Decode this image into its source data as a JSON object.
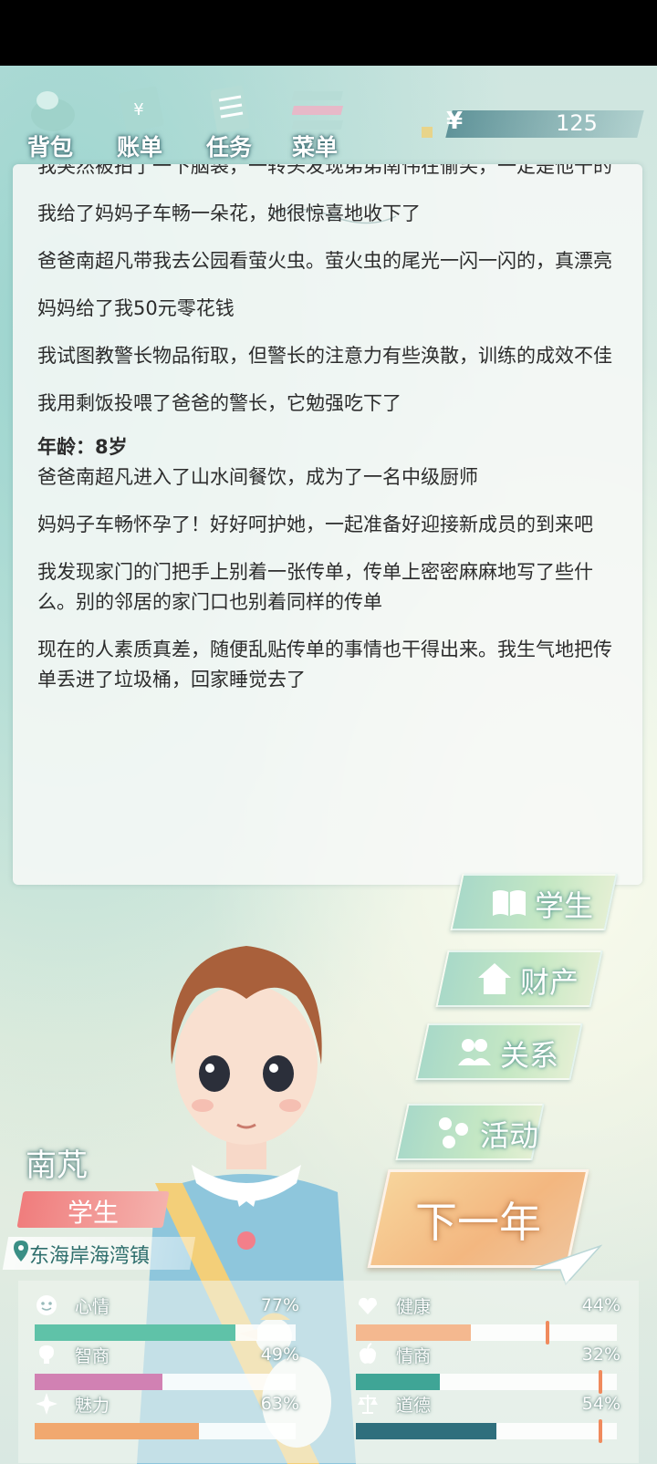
{
  "topbar": {
    "buttons": [
      {
        "label": "背包",
        "icon": "backpack-icon"
      },
      {
        "label": "账单",
        "icon": "bill-icon"
      },
      {
        "label": "任务",
        "icon": "task-icon"
      },
      {
        "label": "菜单",
        "icon": "menu-icon"
      }
    ],
    "money": {
      "symbol": "¥",
      "value": "125"
    }
  },
  "log": {
    "entries": [
      {
        "text": "我突然被拍了一下脑袋，一转头发现弟弟南伟在偷笑，一定是他干的"
      },
      {
        "text": "我给了妈妈子车畅一朵花，她很惊喜地收下了"
      },
      {
        "text": "爸爸南超凡带我去公园看萤火虫。萤火虫的尾光一闪一闪的，真漂亮"
      },
      {
        "text": "妈妈给了我50元零花钱"
      },
      {
        "text": "我试图教警长物品衔取，但警长的注意力有些涣散，训练的成效不佳"
      },
      {
        "text": "我用剩饭投喂了爸爸的警长，它勉强吃下了"
      }
    ],
    "age_heading": "年龄：8岁",
    "entries2": [
      {
        "text": "爸爸南超凡进入了山水间餐饮，成为了一名中级厨师"
      },
      {
        "text": "妈妈子车畅怀孕了！好好呵护她，一起准备好迎接新成员的到来吧"
      },
      {
        "text": "我发现家门的门把手上别着一张传单，传单上密密麻麻地写了些什么。别的邻居的家门口也别着同样的传单"
      },
      {
        "text": "现在的人素质真差，随便乱贴传单的事情也干得出来。我生气地把传单丢进了垃圾桶，回家睡觉去了"
      }
    ]
  },
  "menu": {
    "student": "学生",
    "property": "财产",
    "relations": "关系",
    "activity": "活动",
    "next_year": "下一年"
  },
  "character": {
    "name": "南芃",
    "job": "学生",
    "location": "东海岸海湾镇"
  },
  "stats": [
    {
      "name": "心情",
      "pct": "77%",
      "value": 0.77,
      "color": "#5fc2a8",
      "icon": "smile-icon"
    },
    {
      "name": "健康",
      "pct": "44%",
      "value": 0.44,
      "color": "#f4b88f",
      "icon": "heart-icon"
    },
    {
      "name": "智商",
      "pct": "49%",
      "value": 0.49,
      "color": "#d181b3",
      "icon": "brain-icon"
    },
    {
      "name": "情商",
      "pct": "32%",
      "value": 0.32,
      "color": "#3fa596",
      "icon": "apple-icon"
    },
    {
      "name": "魅力",
      "pct": "63%",
      "value": 0.63,
      "color": "#f1a86f",
      "icon": "sparkle-icon"
    },
    {
      "name": "道德",
      "pct": "54%",
      "value": 0.54,
      "color": "#2f6f7d",
      "icon": "scale-icon"
    }
  ]
}
